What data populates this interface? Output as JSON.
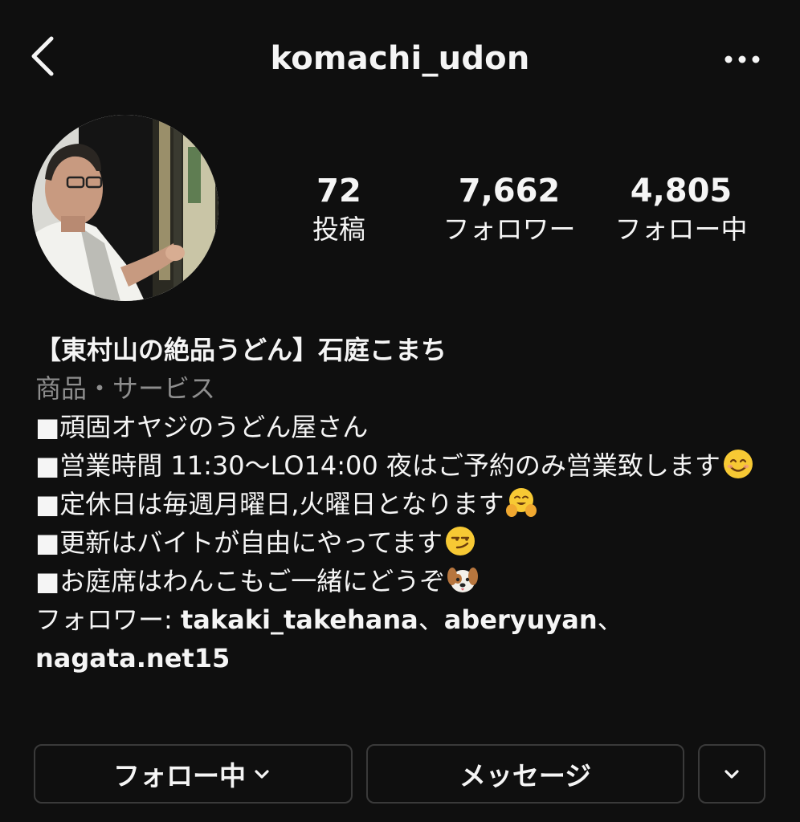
{
  "header": {
    "username": "komachi_udon",
    "back_icon": "chevron-left-icon",
    "more_icon": "ellipsis-icon"
  },
  "profile": {
    "avatar_alt": "profile photo",
    "stats": [
      {
        "count": "72",
        "label": "投稿"
      },
      {
        "count": "7,662",
        "label": "フォロワー"
      },
      {
        "count": "4,805",
        "label": "フォロー中"
      }
    ]
  },
  "bio": {
    "name": "【東村山の絶品うどん】石庭こまち",
    "category": "商品・サービス",
    "lines": [
      {
        "text": "■頑固オヤジのうどん屋さん",
        "emoji": ""
      },
      {
        "text": "■営業時間 11:30〜LO14:00 夜はご予約のみ営業致します",
        "emoji": "smiling-face-icon"
      },
      {
        "text": "■定休日は毎週月曜日,火曜日となります",
        "emoji": "hugging-face-icon"
      },
      {
        "text": "■更新はバイトが自由にやってます",
        "emoji": "smirking-face-icon"
      },
      {
        "text": "■お庭席はわんこもご一緒にどうぞ",
        "emoji": "dog-face-icon"
      }
    ],
    "followed_by_prefix": "フォロワー: ",
    "followed_by": [
      "takaki_takehana",
      "aberyuyan",
      "nagata.net15"
    ],
    "separator": "、"
  },
  "actions": {
    "following_label": "フォロー中",
    "message_label": "メッセージ",
    "suggest_icon": "chevron-down-icon"
  },
  "colors": {
    "background": "#0f0f0f",
    "text": "#f5f5f5",
    "secondary_text": "#8e8e8e",
    "button_border": "#3a3a3a"
  }
}
